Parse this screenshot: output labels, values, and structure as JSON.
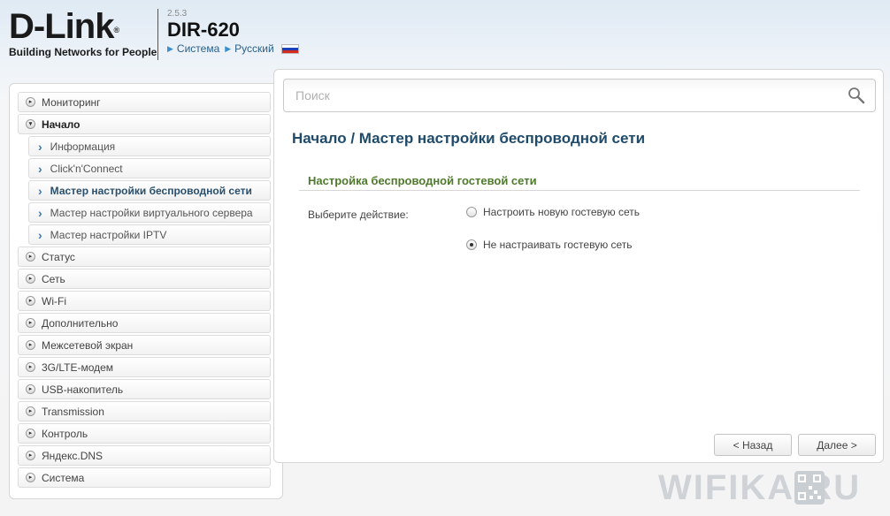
{
  "header": {
    "logo_text": "D-Link",
    "logo_mark": "®",
    "logo_tagline": "Building Networks for People",
    "firmware_version": "2.5.3",
    "model": "DIR-620",
    "links": [
      "Система",
      "Русский"
    ],
    "flag_icon": "russia-flag-icon",
    "flag_colors": [
      "#ffffff",
      "#1c3fb8",
      "#d52b1e"
    ]
  },
  "sidebar": {
    "items": [
      {
        "label": "Мониторинг",
        "type": "collapsed"
      },
      {
        "label": "Начало",
        "type": "open"
      },
      {
        "label": "Информация",
        "type": "sub"
      },
      {
        "label": "Click'n'Connect",
        "type": "sub"
      },
      {
        "label": "Мастер настройки беспроводной сети",
        "type": "sub-active"
      },
      {
        "label": "Мастер настройки виртуального сервера",
        "type": "sub"
      },
      {
        "label": "Мастер настройки IPTV",
        "type": "sub"
      },
      {
        "label": "Статус",
        "type": "collapsed"
      },
      {
        "label": "Сеть",
        "type": "collapsed"
      },
      {
        "label": "Wi-Fi",
        "type": "collapsed"
      },
      {
        "label": "Дополнительно",
        "type": "collapsed"
      },
      {
        "label": "Межсетевой экран",
        "type": "collapsed"
      },
      {
        "label": "3G/LTE-модем",
        "type": "collapsed"
      },
      {
        "label": "USB-накопитель",
        "type": "collapsed"
      },
      {
        "label": "Transmission",
        "type": "collapsed"
      },
      {
        "label": "Контроль",
        "type": "collapsed"
      },
      {
        "label": "Яндекс.DNS",
        "type": "collapsed"
      },
      {
        "label": "Система",
        "type": "collapsed"
      }
    ]
  },
  "main": {
    "search_placeholder": "Поиск",
    "breadcrumb": "Начало /  Мастер настройки беспроводной сети",
    "section_title": "Настройка беспроводной гостевой сети",
    "field_label": "Выберите действие:",
    "options": [
      {
        "label": "Настроить новую гостевую сеть",
        "checked": false
      },
      {
        "label": "Не настраивать гостевую сеть",
        "checked": true
      }
    ],
    "back_button": "< Назад",
    "next_button": "Далее >"
  },
  "watermark": {
    "text": "WIFIKA.RU",
    "color": "#c9ced3"
  },
  "colors": {
    "title": "#1f4a6a",
    "section": "#4f7a2c",
    "accent": "#3a8fd0"
  }
}
